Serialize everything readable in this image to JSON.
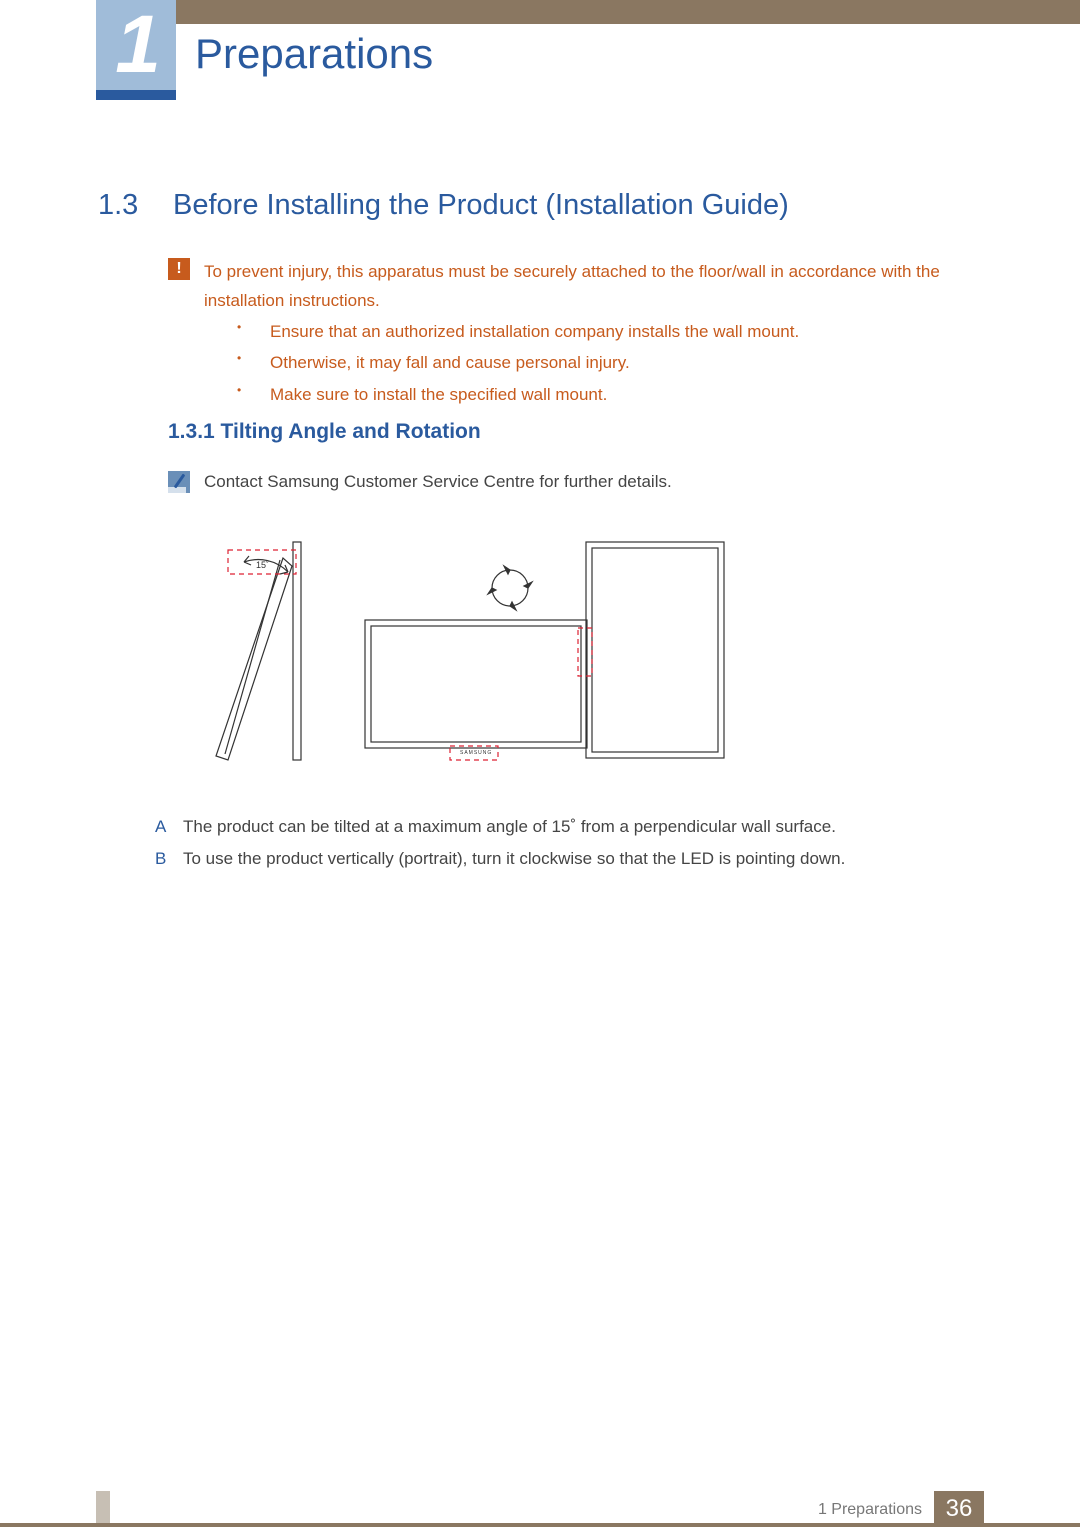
{
  "chapter": {
    "number": "1",
    "title": "Preparations"
  },
  "section": {
    "number": "1.3",
    "title": "Before Installing the Product (Installation Guide)"
  },
  "caution": {
    "intro": "To prevent injury, this apparatus must be securely attached to the floor/wall in accordance with the installation instructions.",
    "bullets": [
      "Ensure that an authorized installation company installs the wall mount.",
      "Otherwise, it may fall and cause personal injury.",
      "Make sure to install the specified wall mount."
    ]
  },
  "subsection": {
    "label": "1.3.1  Tilting Angle and Rotation"
  },
  "note": {
    "text": "Contact Samsung Customer Service Centre for further details."
  },
  "diagram": {
    "tilt_label": "15˚",
    "brand_label": "SAMSUNG"
  },
  "legend": {
    "a": {
      "letter": "A",
      "text": "The product can be tilted at a maximum angle of 15˚ from a perpendicular wall surface."
    },
    "b": {
      "letter": "B",
      "text": "To use the product vertically (portrait), turn it clockwise so that the LED is pointing down."
    }
  },
  "footer": {
    "crumb": "1 Preparations",
    "page": "36"
  }
}
